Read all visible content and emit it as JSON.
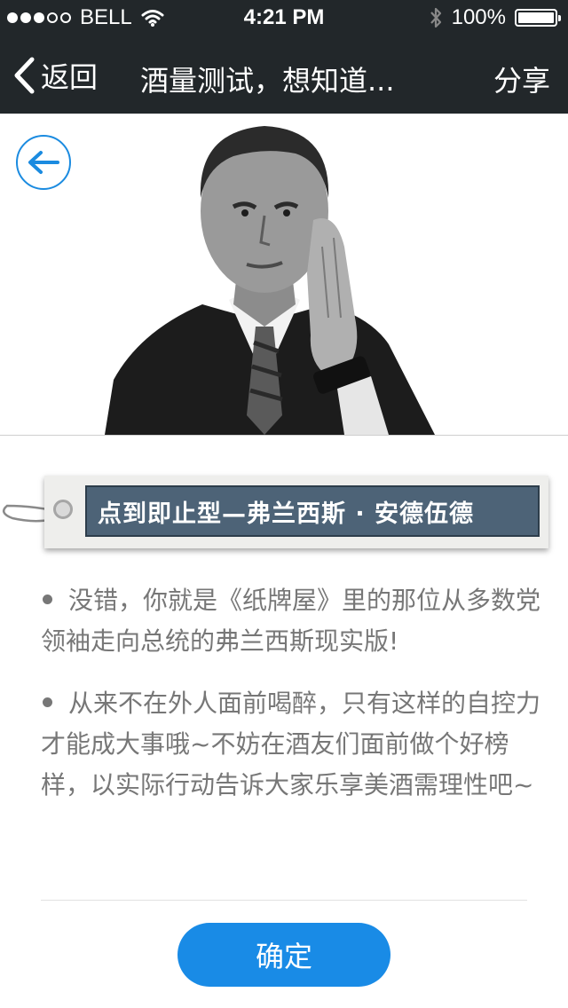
{
  "status_bar": {
    "carrier": "BELL",
    "time": "4:21 PM",
    "battery": "100%",
    "battery_level": 1.0,
    "signal_bars_filled": 3,
    "signal_bars_total": 5
  },
  "nav": {
    "back_label": "返回",
    "title": "酒量测试，想知道...",
    "share_label": "分享"
  },
  "result": {
    "tag_text": "点到即止型—弗兰西斯 · 安德伍德",
    "paragraphs": [
      "没错，你就是《纸牌屋》里的那位从多数党领袖走向总统的弗兰西斯现实版!",
      "从来不在外人面前喝醉，只有这样的自控力才能成大事哦~不妨在酒友们面前做个好榜样，以实际行动告诉大家乐享美酒需理性吧~"
    ]
  },
  "confirm_label": "确定",
  "colors": {
    "bar_bg": "#22272a",
    "accent": "#198be6",
    "tag_bg": "#4d6377",
    "body_text": "#777777"
  },
  "icons": [
    "wifi-icon",
    "bluetooth-icon",
    "battery-icon",
    "chevron-left-icon",
    "arrow-left-icon"
  ]
}
